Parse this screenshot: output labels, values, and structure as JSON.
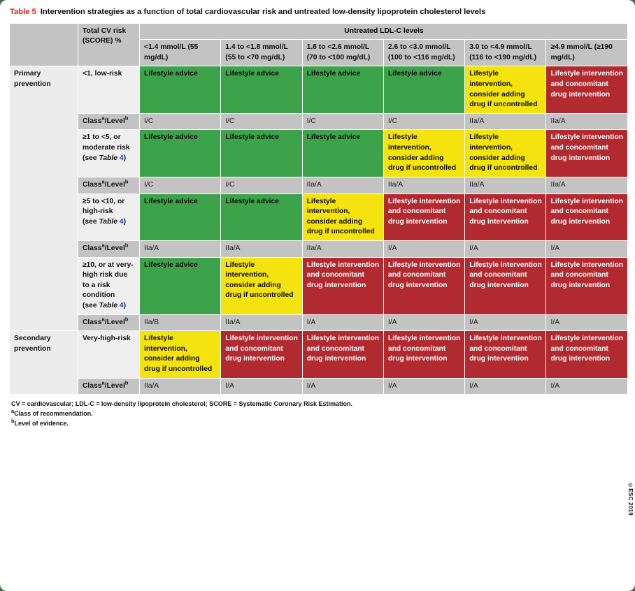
{
  "caption": {
    "table_number": "Table 5",
    "text": "Intervention strategies as a function of total cardiovascular risk and untreated low-density lipoprotein cholesterol levels"
  },
  "header": {
    "col_risk": "Total CV risk (SCORE) %",
    "col_ldl_group": "Untreated LDL-C levels",
    "ldl_columns": [
      "<1.4 mmol/L (55 mg/dL)",
      "1.4 to <1.8 mmol/L (55 to <70 mg/dL)",
      "1.8 to <2.6 mmol/L (70 to <100 mg/dL)",
      "2.6 to <3.0 mmol/L (100 to <116 mg/dL)",
      "3.0 to <4.9 mmol/L (116 to <190 mg/dL)",
      "≥4.9 mmol/L (≥190 mg/dL)"
    ]
  },
  "labels": {
    "class_level": "Class",
    "class_sup": "a",
    "level_word": "Level",
    "level_sup": "b",
    "primary": "Primary prevention",
    "secondary": "Secondary prevention",
    "see": "(see ",
    "table_word": "Table",
    "table_ref": "4",
    "close_paren": ")"
  },
  "text_options": {
    "lifestyle_advice": "Lifestyle advice",
    "lifestyle_consider": "Lifestyle intervention, consider adding drug if uncontrolled",
    "lifestyle_concomitant": "Lifestyle intervention and concomitant drug intervention"
  },
  "colors": {
    "green": "#3ca34a",
    "yellow": "#f5e310",
    "red": "#b02a30",
    "header_grey": "#c3c3c3",
    "row_grey": "#efefef",
    "accent_red": "#e02020",
    "link_blue": "#1a3bd6"
  },
  "rows": [
    {
      "section": "Primary prevention",
      "risk": "<1, low-risk",
      "risk_has_table_ref": false,
      "cells": [
        {
          "color": "green",
          "text": "Lifestyle advice"
        },
        {
          "color": "green",
          "text": "Lifestyle advice"
        },
        {
          "color": "green",
          "text": "Lifestyle advice"
        },
        {
          "color": "green",
          "text": "Lifestyle advice"
        },
        {
          "color": "yellow",
          "text": "Lifestyle intervention, consider adding drug if uncontrolled"
        },
        {
          "color": "red",
          "text": "Lifestyle intervention and concomitant drug intervention"
        }
      ],
      "class_level": [
        "I/C",
        "I/C",
        "I/C",
        "I/C",
        "IIa/A",
        "IIa/A"
      ]
    },
    {
      "section": "",
      "risk": "≥1 to <5, or moderate risk",
      "risk_has_table_ref": true,
      "cells": [
        {
          "color": "green",
          "text": "Lifestyle advice"
        },
        {
          "color": "green",
          "text": "Lifestyle advice"
        },
        {
          "color": "green",
          "text": "Lifestyle advice"
        },
        {
          "color": "yellow",
          "text": "Lifestyle intervention, consider adding drug if uncontrolled"
        },
        {
          "color": "yellow",
          "text": "Lifestyle intervention, consider adding drug if uncontrolled"
        },
        {
          "color": "red",
          "text": "Lifestyle intervention and concomitant drug intervention"
        }
      ],
      "class_level": [
        "I/C",
        "I/C",
        "IIa/A",
        "IIa/A",
        "IIa/A",
        "IIa/A"
      ]
    },
    {
      "section": "",
      "risk": "≥5 to <10, or high-risk",
      "risk_has_table_ref": true,
      "cells": [
        {
          "color": "green",
          "text": "Lifestyle advice"
        },
        {
          "color": "green",
          "text": "Lifestyle advice"
        },
        {
          "color": "yellow",
          "text": "Lifestyle intervention, consider adding drug if uncontrolled"
        },
        {
          "color": "red",
          "text": "Lifestyle intervention and concomitant drug intervention"
        },
        {
          "color": "red",
          "text": "Lifestyle intervention and concomitant drug intervention"
        },
        {
          "color": "red",
          "text": "Lifestyle intervention and concomitant drug intervention"
        }
      ],
      "class_level": [
        "IIa/A",
        "IIa/A",
        "IIa/A",
        "I/A",
        "I/A",
        "I/A"
      ]
    },
    {
      "section": "",
      "risk": "≥10, or at very-high risk due to a risk condition",
      "risk_has_table_ref": true,
      "cells": [
        {
          "color": "green",
          "text": "Lifestyle advice"
        },
        {
          "color": "yellow",
          "text": "Lifestyle intervention, consider adding drug if uncontrolled"
        },
        {
          "color": "red",
          "text": "Lifestyle intervention and concomitant drug intervention"
        },
        {
          "color": "red",
          "text": "Lifestyle intervention and concomitant drug intervention"
        },
        {
          "color": "red",
          "text": "Lifestyle intervention and concomitant drug intervention"
        },
        {
          "color": "red",
          "text": "Lifestyle intervention and concomitant drug intervention"
        }
      ],
      "class_level": [
        "IIa/B",
        "IIa/A",
        "I/A",
        "I/A",
        "I/A",
        "I/A"
      ]
    },
    {
      "section": "Secondary prevention",
      "risk": "Very-high-risk",
      "risk_has_table_ref": false,
      "cells": [
        {
          "color": "yellow",
          "text": "Lifestyle intervention, consider adding drug if uncontrolled"
        },
        {
          "color": "red",
          "text": "Lifestyle intervention and concomitant drug intervention"
        },
        {
          "color": "red",
          "text": "Lifestyle intervention and concomitant drug intervention"
        },
        {
          "color": "red",
          "text": "Lifestyle intervention and concomitant drug intervention"
        },
        {
          "color": "red",
          "text": "Lifestyle intervention and concomitant drug intervention"
        },
        {
          "color": "red",
          "text": "Lifestyle intervention and concomitant drug intervention"
        }
      ],
      "class_level": [
        "IIa/A",
        "I/A",
        "I/A",
        "I/A",
        "I/A",
        "I/A"
      ]
    }
  ],
  "copyright": "©ESC 2019",
  "footnotes": [
    "CV = cardiovascular; LDL-C = low-density lipoprotein cholesterol; SCORE = Systematic Coronary Risk Estimation.",
    "Class of recommendation.",
    "Level of evidence."
  ],
  "footnote_marks": [
    "",
    "a",
    "b"
  ]
}
